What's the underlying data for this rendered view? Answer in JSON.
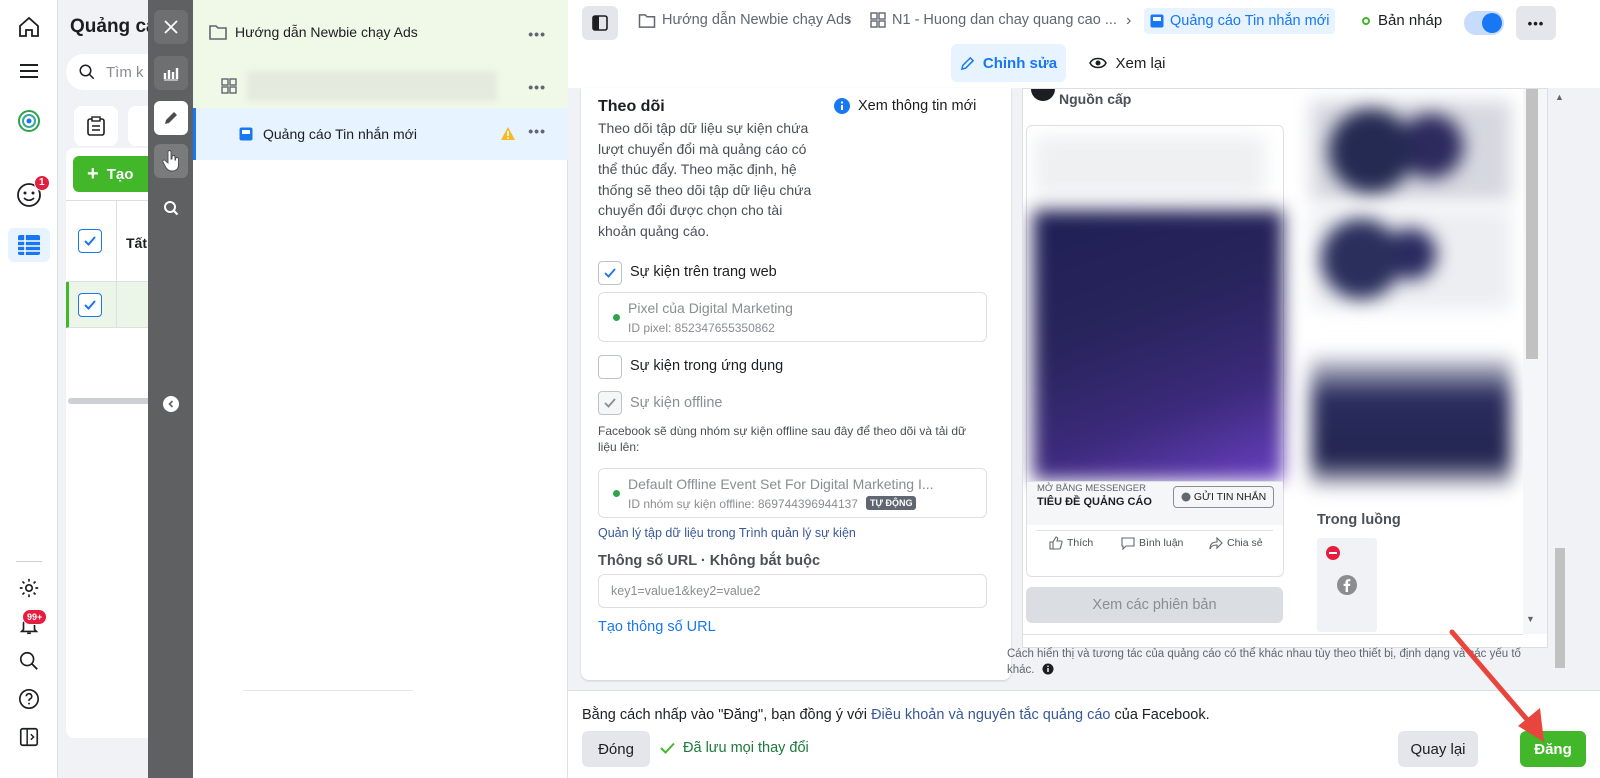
{
  "leftnav": {
    "notifications_badge": "1",
    "alerts_badge": "99+"
  },
  "campaign_panel": {
    "title": "Quảng cá",
    "search_placeholder": "Tìm k",
    "create_label": "Tạo",
    "col_all": "Tất"
  },
  "tree": {
    "campaign": "Hướng dẫn Newbie chạy Ads",
    "ad": "Quảng cáo Tin nhắn mới"
  },
  "topbar": {
    "crumb_campaign": "Hướng dẫn Newbie chạy Ads",
    "crumb_adset": "N1 - Huong dan chay quang cao ...",
    "crumb_ad": "Quảng cáo Tin nhắn mới",
    "status": "Bản nháp",
    "tab_edit": "Chỉnh sửa",
    "tab_review": "Xem lại"
  },
  "tracking": {
    "title": "Theo dõi",
    "info_link": "Xem thông tin mới",
    "description": "Theo dõi tập dữ liệu sự kiện chứa lượt chuyển đổi mà quảng cáo có thể thúc đẩy. Theo mặc định, hệ thống sẽ theo dõi tập dữ liệu chứa chuyển đổi được chọn cho tài khoản quảng cáo.",
    "web_events": "Sự kiện trên trang web",
    "pixel_name": "Pixel của Digital Marketing",
    "pixel_id": "ID pixel: 852347655350862",
    "app_events": "Sự kiện trong ứng dụng",
    "offline_events": "Sự kiện offline",
    "offline_note": "Facebook sẽ dùng nhóm sự kiện offline sau đây để theo dõi và tải dữ liệu lên:",
    "offline_set_name": "Default Offline Event Set For Digital Marketing I...",
    "offline_set_id": "ID nhóm sự kiện offline: 869744396944137",
    "auto_badge": "TỰ ĐỘNG",
    "manage_link": "Quản lý tập dữ liệu trong Trình quản lý sự kiện",
    "url_params_title": "Thông số URL · Không bắt buộc",
    "url_params_placeholder": "key1=value1&key2=value2",
    "build_url_link": "Tạo thông số URL"
  },
  "preview": {
    "feed_label": "Nguồn cấp",
    "cta_caption": "MỞ BẰNG MESSENGER",
    "headline": "TIÊU ĐỀ QUẢNG CÁO",
    "cta_button": "GỬI TIN NHẮN",
    "like": "Thích",
    "comment": "Bình luận",
    "share": "Chia sẻ",
    "see_versions": "Xem các phiên bản",
    "instream_label": "Trong luồng",
    "disclaimer": "Cách hiển thị và tương tác của quảng cáo có thể khác nhau tùy theo thiết bị, định dạng và các yếu tố khác."
  },
  "footer": {
    "terms_prefix": "Bằng cách nhấp vào \"Đăng\", bạn đồng ý với ",
    "terms_link": "Điều khoản và nguyên tắc quảng cáo",
    "terms_suffix": " của Facebook.",
    "close_label": "Đóng",
    "saved_label": "Đã lưu mọi thay đổi",
    "back_label": "Quay lại",
    "publish_label": "Đăng"
  },
  "colors": {
    "accent_blue": "#1877f2",
    "publish_green": "#42b72a",
    "arrow_red": "#e8453c"
  }
}
